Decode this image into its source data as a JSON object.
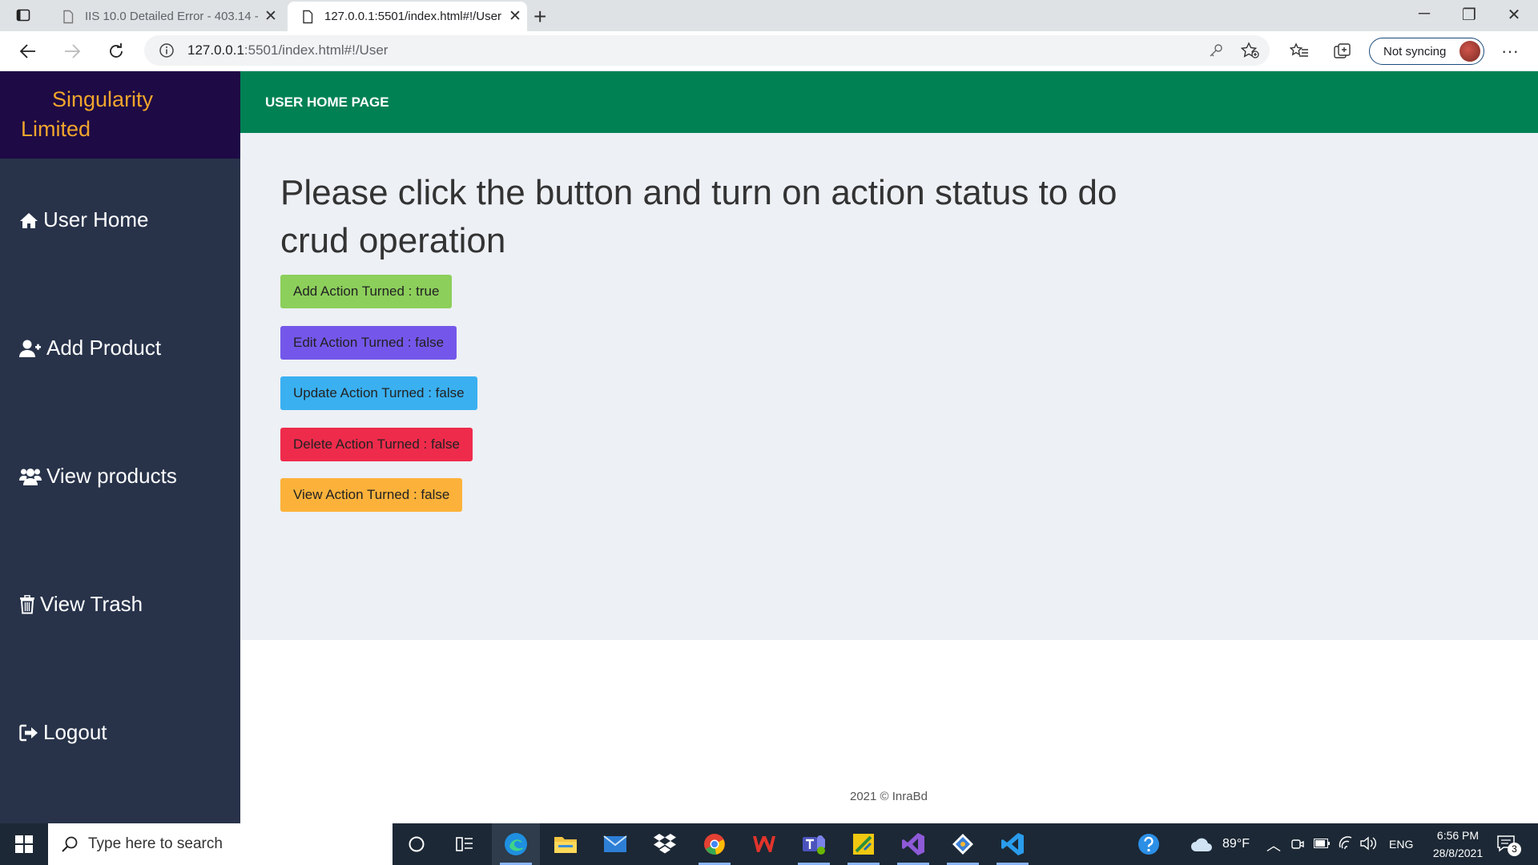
{
  "browser": {
    "tabs": [
      {
        "title": "IIS 10.0 Detailed Error - 403.14 -",
        "active": false
      },
      {
        "title": "127.0.0.1:5501/index.html#!/User",
        "active": true
      }
    ],
    "address": {
      "host": "127.0.0.1",
      "rest": ":5501/index.html#!/User"
    },
    "sync_label": "Not syncing"
  },
  "sidebar": {
    "brand_line1": "Singularity",
    "brand_line2": "Limited",
    "items": [
      {
        "label": "User Home",
        "icon": "home-icon"
      },
      {
        "label": "Add Product",
        "icon": "user-plus-icon"
      },
      {
        "label": "View products",
        "icon": "users-icon"
      },
      {
        "label": "View Trash",
        "icon": "trash-icon"
      },
      {
        "label": "Logout",
        "icon": "sign-out-icon"
      }
    ]
  },
  "header": {
    "title": "USER HOME PAGE"
  },
  "main": {
    "heading": "Please click the button and turn on action status to do crud operation",
    "buttons": [
      {
        "label": "Add Action Turned : true",
        "color": "#8ccf5b"
      },
      {
        "label": "Edit Action Turned : false",
        "color": "#7457ea"
      },
      {
        "label": "Update Action Turned : false",
        "color": "#3ab0f0"
      },
      {
        "label": "Delete Action Turned : false",
        "color": "#ef2b4c"
      },
      {
        "label": "View Action Turned : false",
        "color": "#fcb23a"
      }
    ]
  },
  "footer": {
    "text": "2021 © InraBd"
  },
  "taskbar": {
    "search_placeholder": "Type here to search",
    "weather": "89°F",
    "language": "ENG",
    "time": "6:56 PM",
    "date": "28/8/2021",
    "notifications": "3"
  }
}
